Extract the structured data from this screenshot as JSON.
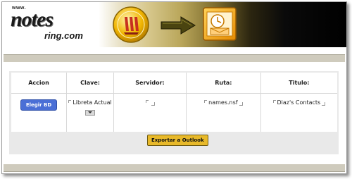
{
  "brand": {
    "www": "www.",
    "notes": "notes",
    "ring": "ring.com"
  },
  "table": {
    "headers": [
      "Accion",
      "Clave:",
      "Servidor:",
      "Ruta:",
      "Titulo:"
    ],
    "row": {
      "action_button": "Elegir BD",
      "clave": "Libreta Actual",
      "servidor": "",
      "ruta": "names.nsf",
      "titulo": "Diaz's Contacts"
    }
  },
  "export_button": "Exportar a Outlook",
  "icons": [
    "lotus-notes-icon",
    "right-arrow-icon",
    "outlook-icon"
  ],
  "colors": {
    "action_button": "#4a6fd6",
    "export_button": "#e8b92a",
    "band": "#cfcbbd",
    "panel": "#e9e9e9"
  }
}
